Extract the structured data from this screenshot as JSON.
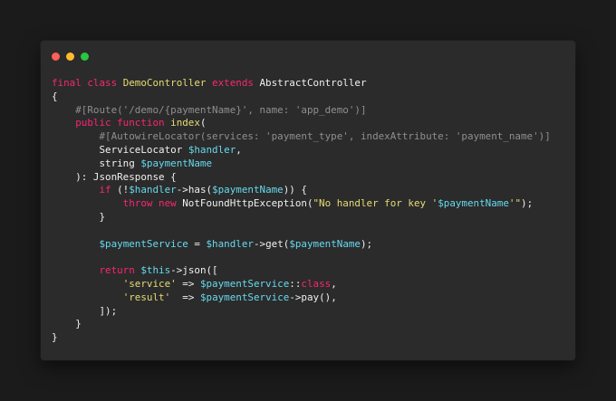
{
  "window": {
    "traffic_lights": [
      {
        "name": "close",
        "color": "#ff5f57"
      },
      {
        "name": "minimize",
        "color": "#febc2e"
      },
      {
        "name": "zoom",
        "color": "#28c840"
      }
    ]
  },
  "code": {
    "lines": [
      [
        {
          "t": "final class ",
          "c": "kw"
        },
        {
          "t": "DemoController",
          "c": "cls"
        },
        {
          "t": " extends ",
          "c": "kw"
        },
        {
          "t": "AbstractController",
          "c": "plain"
        }
      ],
      [
        {
          "t": "{",
          "c": "plain"
        }
      ],
      [
        {
          "t": "    #[Route('/demo/{paymentName}', name: 'app_demo')]",
          "c": "cmt"
        }
      ],
      [
        {
          "t": "    public function ",
          "c": "kw"
        },
        {
          "t": "index",
          "c": "cls"
        },
        {
          "t": "(",
          "c": "plain"
        }
      ],
      [
        {
          "t": "        #[AutowireLocator(services: 'payment_type', indexAttribute: 'payment_name')]",
          "c": "cmt"
        }
      ],
      [
        {
          "t": "        ServiceLocator ",
          "c": "plain"
        },
        {
          "t": "$handler",
          "c": "var"
        },
        {
          "t": ",",
          "c": "plain"
        }
      ],
      [
        {
          "t": "        string ",
          "c": "plain"
        },
        {
          "t": "$paymentName",
          "c": "var"
        }
      ],
      [
        {
          "t": "    ): JsonResponse {",
          "c": "plain"
        }
      ],
      [
        {
          "t": "        if ",
          "c": "kw"
        },
        {
          "t": "(!",
          "c": "plain"
        },
        {
          "t": "$handler",
          "c": "var"
        },
        {
          "t": "->has(",
          "c": "plain"
        },
        {
          "t": "$paymentName",
          "c": "var"
        },
        {
          "t": ")) {",
          "c": "plain"
        }
      ],
      [
        {
          "t": "            throw new ",
          "c": "kw"
        },
        {
          "t": "NotFoundHttpException(",
          "c": "plain"
        },
        {
          "t": "\"No handler for key '",
          "c": "str"
        },
        {
          "t": "$paymentName",
          "c": "var"
        },
        {
          "t": "'\"",
          "c": "str"
        },
        {
          "t": ");",
          "c": "plain"
        }
      ],
      [
        {
          "t": "        }",
          "c": "plain"
        }
      ],
      [
        {
          "t": "",
          "c": "plain"
        }
      ],
      [
        {
          "t": "        ",
          "c": "plain"
        },
        {
          "t": "$paymentService",
          "c": "var"
        },
        {
          "t": " = ",
          "c": "plain"
        },
        {
          "t": "$handler",
          "c": "var"
        },
        {
          "t": "->get(",
          "c": "plain"
        },
        {
          "t": "$paymentName",
          "c": "var"
        },
        {
          "t": ");",
          "c": "plain"
        }
      ],
      [
        {
          "t": "",
          "c": "plain"
        }
      ],
      [
        {
          "t": "        return ",
          "c": "kw"
        },
        {
          "t": "$this",
          "c": "var"
        },
        {
          "t": "->json([",
          "c": "plain"
        }
      ],
      [
        {
          "t": "            ",
          "c": "plain"
        },
        {
          "t": "'service'",
          "c": "str"
        },
        {
          "t": " => ",
          "c": "plain"
        },
        {
          "t": "$paymentService",
          "c": "var"
        },
        {
          "t": "::",
          "c": "plain"
        },
        {
          "t": "class",
          "c": "kw"
        },
        {
          "t": ",",
          "c": "plain"
        }
      ],
      [
        {
          "t": "            ",
          "c": "plain"
        },
        {
          "t": "'result'",
          "c": "str"
        },
        {
          "t": "  => ",
          "c": "plain"
        },
        {
          "t": "$paymentService",
          "c": "var"
        },
        {
          "t": "->pay(),",
          "c": "plain"
        }
      ],
      [
        {
          "t": "        ]);",
          "c": "plain"
        }
      ],
      [
        {
          "t": "    }",
          "c": "plain"
        }
      ],
      [
        {
          "t": "}",
          "c": "plain"
        }
      ]
    ]
  },
  "colors": {
    "background": "#1b1b1b",
    "editor": "#2b2b2b",
    "keyword": "#f92672",
    "class": "#e6db74",
    "variable": "#66d9ef",
    "string": "#e6db74",
    "comment": "#8f8f8f",
    "text": "#f0f0f0"
  }
}
